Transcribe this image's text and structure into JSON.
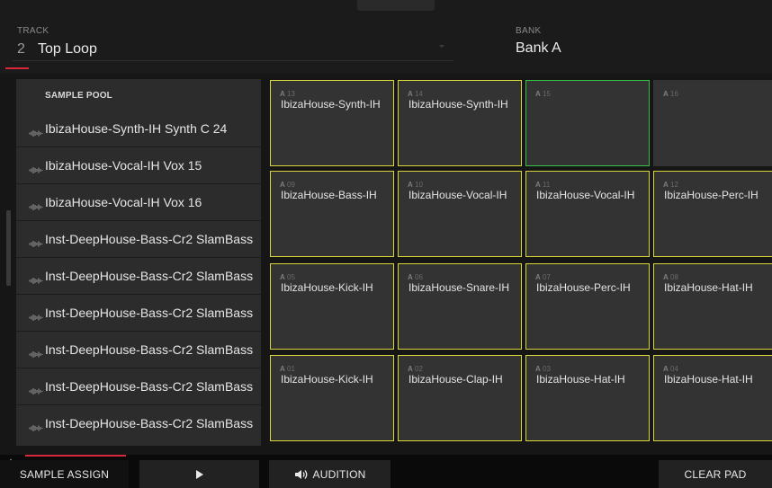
{
  "header": {
    "track_label": "TRACK",
    "track_number": "2",
    "track_name": "Top Loop",
    "bank_label": "BANK",
    "bank_value": "Bank A"
  },
  "sample_pool": {
    "title": "SAMPLE POOL",
    "items": [
      "IbizaHouse-Synth-IH Synth C 24",
      "IbizaHouse-Vocal-IH Vox 15",
      "IbizaHouse-Vocal-IH Vox 16",
      "Inst-DeepHouse-Bass-Cr2 SlamBass",
      "Inst-DeepHouse-Bass-Cr2 SlamBass",
      "Inst-DeepHouse-Bass-Cr2 SlamBass",
      "Inst-DeepHouse-Bass-Cr2 SlamBass",
      "Inst-DeepHouse-Bass-Cr2 SlamBass",
      "Inst-DeepHouse-Bass-Cr2 SlamBass"
    ]
  },
  "pads": [
    {
      "bank": "A",
      "num": "13",
      "name": "IbizaHouse-Synth-IH",
      "state": "assigned"
    },
    {
      "bank": "A",
      "num": "14",
      "name": "IbizaHouse-Synth-IH",
      "state": "assigned"
    },
    {
      "bank": "A",
      "num": "15",
      "name": "",
      "state": "selected"
    },
    {
      "bank": "A",
      "num": "16",
      "name": "",
      "state": "empty"
    },
    {
      "bank": "A",
      "num": "09",
      "name": "IbizaHouse-Bass-IH",
      "state": "assigned"
    },
    {
      "bank": "A",
      "num": "10",
      "name": "IbizaHouse-Vocal-IH",
      "state": "assigned"
    },
    {
      "bank": "A",
      "num": "11",
      "name": "IbizaHouse-Vocal-IH",
      "state": "assigned"
    },
    {
      "bank": "A",
      "num": "12",
      "name": "IbizaHouse-Perc-IH",
      "state": "assigned"
    },
    {
      "bank": "A",
      "num": "05",
      "name": "IbizaHouse-Kick-IH",
      "state": "assigned"
    },
    {
      "bank": "A",
      "num": "06",
      "name": "IbizaHouse-Snare-IH",
      "state": "assigned"
    },
    {
      "bank": "A",
      "num": "07",
      "name": "IbizaHouse-Perc-IH",
      "state": "assigned"
    },
    {
      "bank": "A",
      "num": "08",
      "name": "IbizaHouse-Hat-IH",
      "state": "assigned"
    },
    {
      "bank": "A",
      "num": "01",
      "name": "IbizaHouse-Kick-IH",
      "state": "assigned"
    },
    {
      "bank": "A",
      "num": "02",
      "name": "IbizaHouse-Clap-IH",
      "state": "assigned"
    },
    {
      "bank": "A",
      "num": "03",
      "name": "IbizaHouse-Hat-IH",
      "state": "assigned"
    },
    {
      "bank": "A",
      "num": "04",
      "name": "IbizaHouse-Hat-IH",
      "state": "assigned"
    }
  ],
  "toolbar": {
    "sample_assign": "SAMPLE ASSIGN",
    "play_icon": "play-icon",
    "audition": "AUDITION",
    "audition_icon": "speaker-icon",
    "clear_pad": "CLEAR PAD"
  },
  "colors": {
    "assigned_border": "#d8d53e",
    "selected_border": "#38c04a",
    "accent": "#d9283a"
  }
}
